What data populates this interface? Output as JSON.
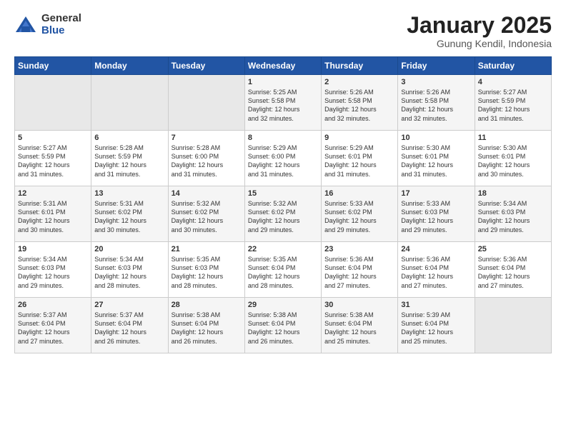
{
  "logo": {
    "general": "General",
    "blue": "Blue"
  },
  "title": "January 2025",
  "location": "Gunung Kendil, Indonesia",
  "days": [
    "Sunday",
    "Monday",
    "Tuesday",
    "Wednesday",
    "Thursday",
    "Friday",
    "Saturday"
  ],
  "weeks": [
    [
      {
        "day": "",
        "info": ""
      },
      {
        "day": "",
        "info": ""
      },
      {
        "day": "",
        "info": ""
      },
      {
        "day": "1",
        "info": "Sunrise: 5:25 AM\nSunset: 5:58 PM\nDaylight: 12 hours\nand 32 minutes."
      },
      {
        "day": "2",
        "info": "Sunrise: 5:26 AM\nSunset: 5:58 PM\nDaylight: 12 hours\nand 32 minutes."
      },
      {
        "day": "3",
        "info": "Sunrise: 5:26 AM\nSunset: 5:58 PM\nDaylight: 12 hours\nand 32 minutes."
      },
      {
        "day": "4",
        "info": "Sunrise: 5:27 AM\nSunset: 5:59 PM\nDaylight: 12 hours\nand 31 minutes."
      }
    ],
    [
      {
        "day": "5",
        "info": "Sunrise: 5:27 AM\nSunset: 5:59 PM\nDaylight: 12 hours\nand 31 minutes."
      },
      {
        "day": "6",
        "info": "Sunrise: 5:28 AM\nSunset: 5:59 PM\nDaylight: 12 hours\nand 31 minutes."
      },
      {
        "day": "7",
        "info": "Sunrise: 5:28 AM\nSunset: 6:00 PM\nDaylight: 12 hours\nand 31 minutes."
      },
      {
        "day": "8",
        "info": "Sunrise: 5:29 AM\nSunset: 6:00 PM\nDaylight: 12 hours\nand 31 minutes."
      },
      {
        "day": "9",
        "info": "Sunrise: 5:29 AM\nSunset: 6:01 PM\nDaylight: 12 hours\nand 31 minutes."
      },
      {
        "day": "10",
        "info": "Sunrise: 5:30 AM\nSunset: 6:01 PM\nDaylight: 12 hours\nand 31 minutes."
      },
      {
        "day": "11",
        "info": "Sunrise: 5:30 AM\nSunset: 6:01 PM\nDaylight: 12 hours\nand 30 minutes."
      }
    ],
    [
      {
        "day": "12",
        "info": "Sunrise: 5:31 AM\nSunset: 6:01 PM\nDaylight: 12 hours\nand 30 minutes."
      },
      {
        "day": "13",
        "info": "Sunrise: 5:31 AM\nSunset: 6:02 PM\nDaylight: 12 hours\nand 30 minutes."
      },
      {
        "day": "14",
        "info": "Sunrise: 5:32 AM\nSunset: 6:02 PM\nDaylight: 12 hours\nand 30 minutes."
      },
      {
        "day": "15",
        "info": "Sunrise: 5:32 AM\nSunset: 6:02 PM\nDaylight: 12 hours\nand 29 minutes."
      },
      {
        "day": "16",
        "info": "Sunrise: 5:33 AM\nSunset: 6:02 PM\nDaylight: 12 hours\nand 29 minutes."
      },
      {
        "day": "17",
        "info": "Sunrise: 5:33 AM\nSunset: 6:03 PM\nDaylight: 12 hours\nand 29 minutes."
      },
      {
        "day": "18",
        "info": "Sunrise: 5:34 AM\nSunset: 6:03 PM\nDaylight: 12 hours\nand 29 minutes."
      }
    ],
    [
      {
        "day": "19",
        "info": "Sunrise: 5:34 AM\nSunset: 6:03 PM\nDaylight: 12 hours\nand 29 minutes."
      },
      {
        "day": "20",
        "info": "Sunrise: 5:34 AM\nSunset: 6:03 PM\nDaylight: 12 hours\nand 28 minutes."
      },
      {
        "day": "21",
        "info": "Sunrise: 5:35 AM\nSunset: 6:03 PM\nDaylight: 12 hours\nand 28 minutes."
      },
      {
        "day": "22",
        "info": "Sunrise: 5:35 AM\nSunset: 6:04 PM\nDaylight: 12 hours\nand 28 minutes."
      },
      {
        "day": "23",
        "info": "Sunrise: 5:36 AM\nSunset: 6:04 PM\nDaylight: 12 hours\nand 27 minutes."
      },
      {
        "day": "24",
        "info": "Sunrise: 5:36 AM\nSunset: 6:04 PM\nDaylight: 12 hours\nand 27 minutes."
      },
      {
        "day": "25",
        "info": "Sunrise: 5:36 AM\nSunset: 6:04 PM\nDaylight: 12 hours\nand 27 minutes."
      }
    ],
    [
      {
        "day": "26",
        "info": "Sunrise: 5:37 AM\nSunset: 6:04 PM\nDaylight: 12 hours\nand 27 minutes."
      },
      {
        "day": "27",
        "info": "Sunrise: 5:37 AM\nSunset: 6:04 PM\nDaylight: 12 hours\nand 26 minutes."
      },
      {
        "day": "28",
        "info": "Sunrise: 5:38 AM\nSunset: 6:04 PM\nDaylight: 12 hours\nand 26 minutes."
      },
      {
        "day": "29",
        "info": "Sunrise: 5:38 AM\nSunset: 6:04 PM\nDaylight: 12 hours\nand 26 minutes."
      },
      {
        "day": "30",
        "info": "Sunrise: 5:38 AM\nSunset: 6:04 PM\nDaylight: 12 hours\nand 25 minutes."
      },
      {
        "day": "31",
        "info": "Sunrise: 5:39 AM\nSunset: 6:04 PM\nDaylight: 12 hours\nand 25 minutes."
      },
      {
        "day": "",
        "info": ""
      }
    ]
  ]
}
